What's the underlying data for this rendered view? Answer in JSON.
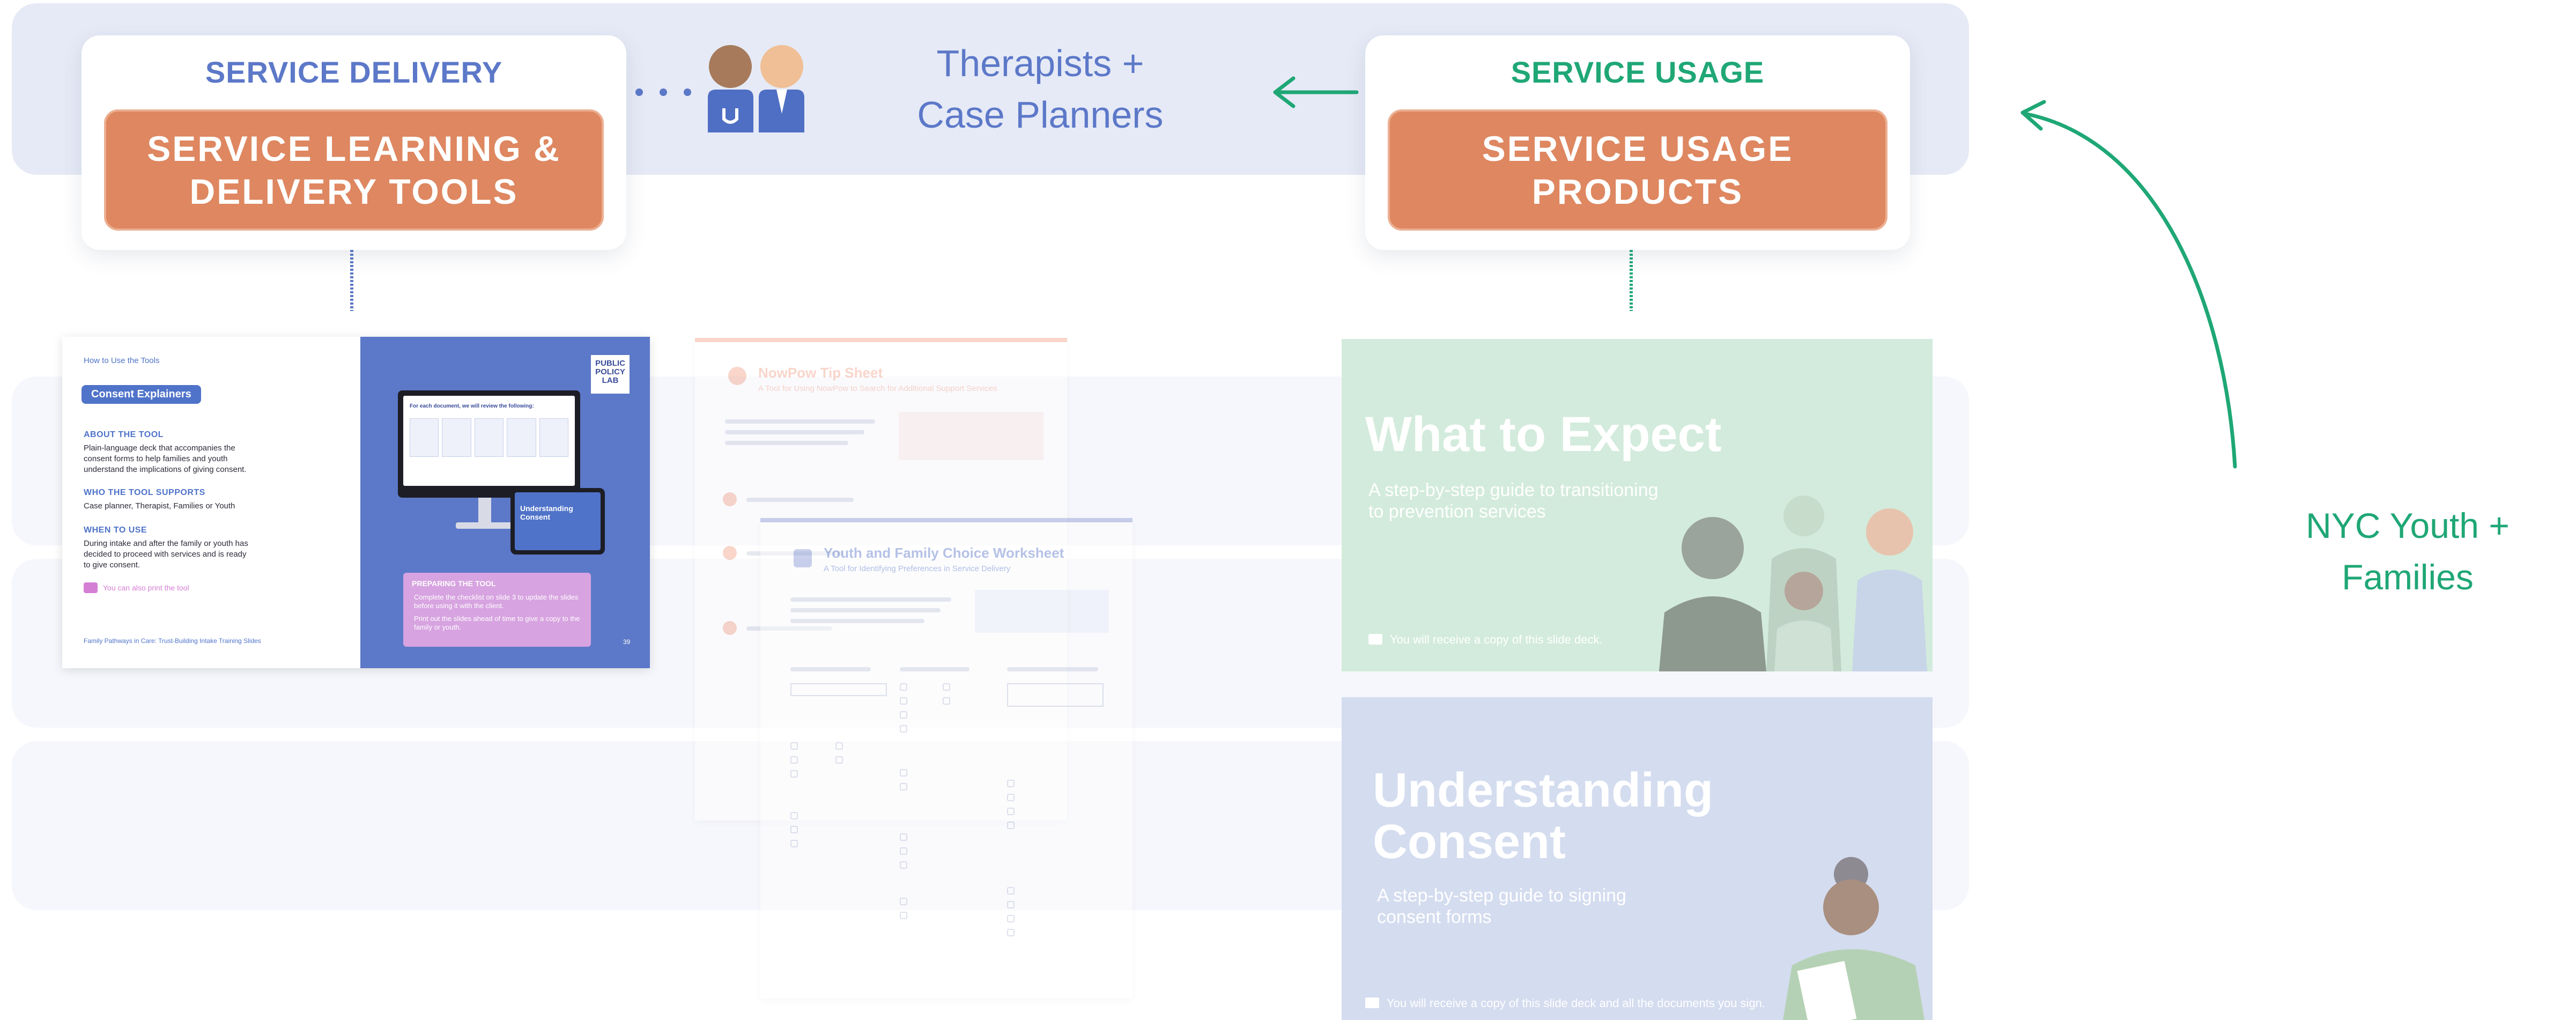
{
  "colors": {
    "blue": "#5c78c8",
    "green": "#1fa776",
    "orange": "#de8760",
    "band": "#e6eaf6"
  },
  "service_delivery": {
    "heading": "SERVICE DELIVERY",
    "box": "SERVICE LEARNING &\nDELIVERY TOOLS"
  },
  "service_usage": {
    "heading": "SERVICE USAGE",
    "box": "SERVICE USAGE\nPRODUCTS"
  },
  "therapists_label": "Therapists +\nCase Planners",
  "youth_label": "NYC Youth +\nFamilies",
  "tool_slide": {
    "section": "How to Use the Tools",
    "pill": "Consent Explainers",
    "about_head": "ABOUT THE TOOL",
    "about_body": "Plain-language deck that accompanies the\nconsent forms to help families and youth\nunderstand the implications of giving consent.",
    "supports_head": "WHO THE TOOL SUPPORTS",
    "supports_body": "Case planner, Therapist, Families or Youth",
    "when_head": "WHEN TO USE",
    "when_body": "During intake and after the family or youth has\ndecided to proceed with services and is ready\nto give consent.",
    "print_note": "You can also print the tool",
    "footer": "Family Pathways in Care: Trust-Building Intake Training Slides",
    "page_number": "39",
    "logo": "PUBLIC\nPOLICY\nLAB",
    "monitor_caption": "For each document, we will review the following:",
    "tablet_title": "Understanding\nConsent",
    "preparing_head": "PREPARING THE TOOL",
    "preparing_items": [
      "Complete the checklist on slide 3 to update the slides before using it with the client.",
      "Print out the slides ahead of time to give a copy to the family or youth."
    ]
  },
  "tip_sheet": {
    "title": "NowPow Tip Sheet",
    "subtitle": "A Tool for Using NowPow to Search for Additional Support Services"
  },
  "worksheet": {
    "title": "Youth and Family Choice Worksheet",
    "subtitle": "A Tool for Identifying Preferences in Service Delivery"
  },
  "expect_card": {
    "title": "What to Expect",
    "subtitle": "A step-by-step guide to transitioning\nto prevention services",
    "note": "You will receive a copy of this slide deck."
  },
  "consent_card": {
    "title": "Understanding\nConsent",
    "subtitle": "A step-by-step guide to signing\nconsent forms",
    "note": "You will receive a copy of this slide deck and all the documents you sign."
  }
}
